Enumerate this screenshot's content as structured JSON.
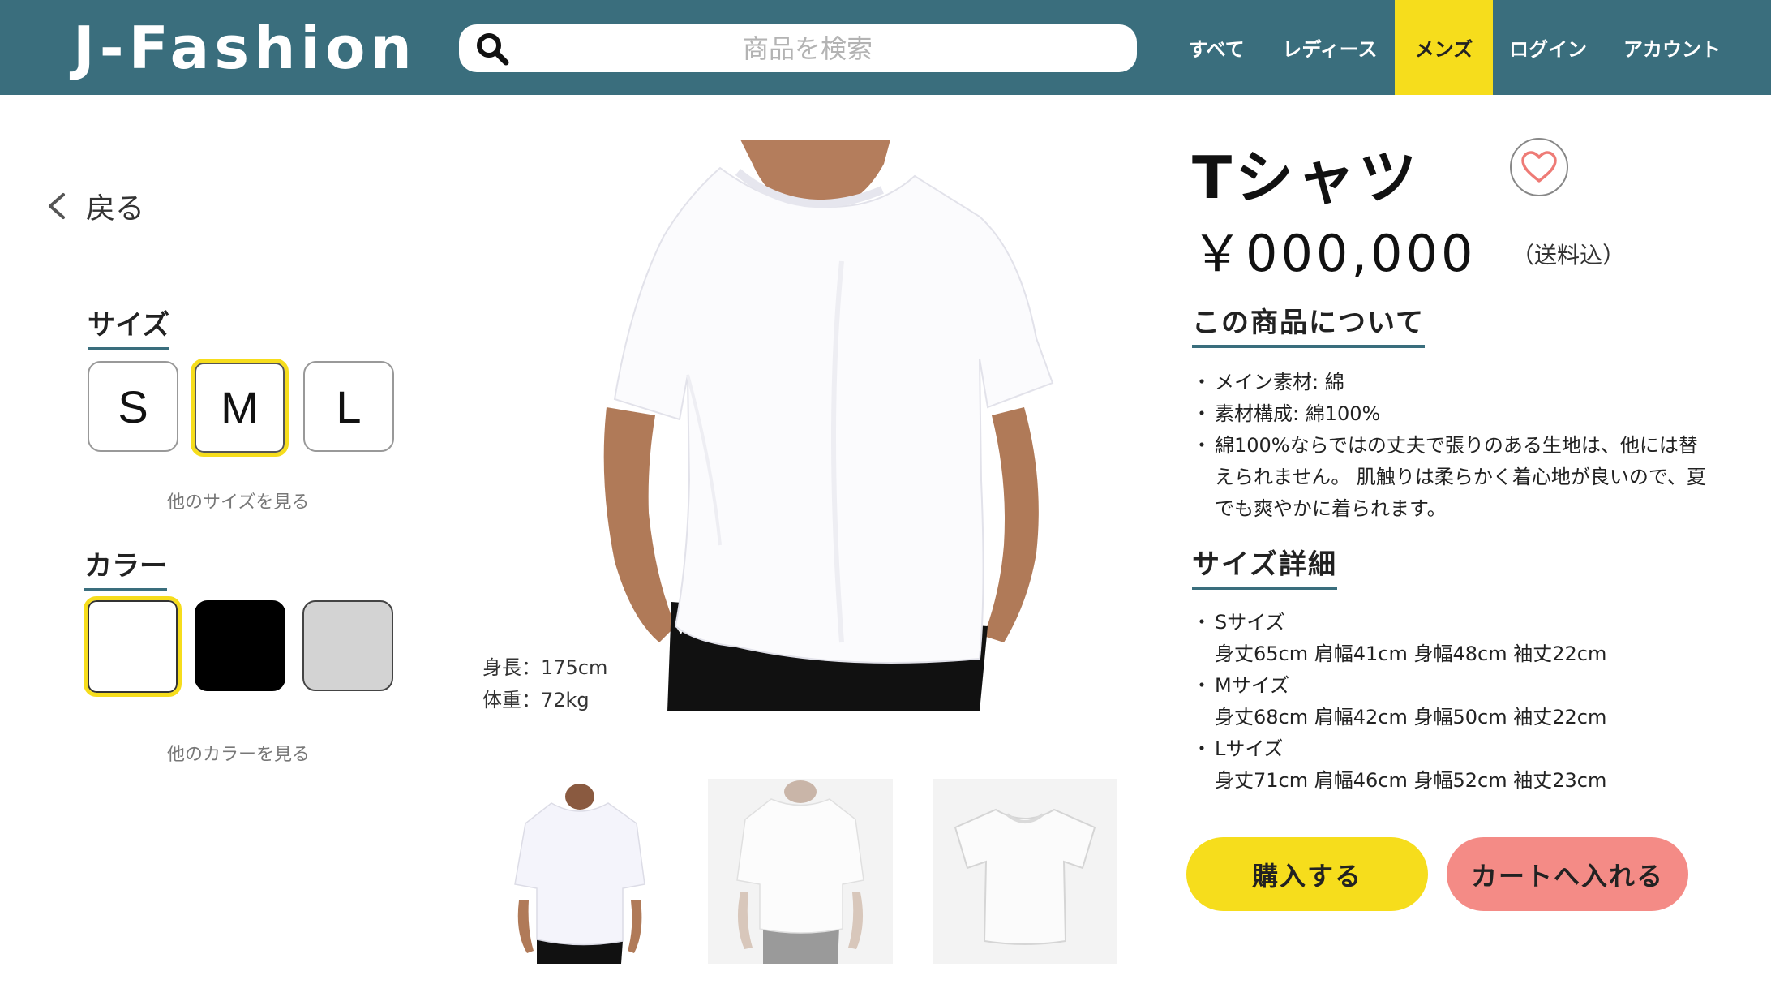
{
  "header": {
    "logo": "J-Fashion",
    "search_placeholder": "商品を検索",
    "nav": [
      {
        "label": "すべて",
        "active": false
      },
      {
        "label": "レディース",
        "active": false
      },
      {
        "label": "メンズ",
        "active": true
      },
      {
        "label": "ログイン",
        "active": false
      },
      {
        "label": "アカウント",
        "active": false
      }
    ]
  },
  "sidebar": {
    "back_label": "戻る",
    "size_title": "サイズ",
    "sizes": [
      {
        "label": "S",
        "selected": false
      },
      {
        "label": "M",
        "selected": true
      },
      {
        "label": "L",
        "selected": false
      }
    ],
    "more_sizes": "他のサイズを見る",
    "color_title": "カラー",
    "colors": [
      {
        "name": "white",
        "hex": "#ffffff",
        "selected": true
      },
      {
        "name": "black",
        "hex": "#000000",
        "selected": false
      },
      {
        "name": "gray",
        "hex": "#d3d3d3",
        "selected": false
      }
    ],
    "more_colors": "他のカラーを見る"
  },
  "gallery": {
    "model_height": "身長：175cm",
    "model_weight": "体重：72kg"
  },
  "product": {
    "title": "Tシャツ",
    "price": "￥000,000",
    "tax_note": "（送料込）",
    "about_title": "この商品について",
    "about_items": [
      "メイン素材: 綿",
      "素材構成: 綿100%",
      "綿100%ならではの丈夫で張りのある生地は、他には替えられません。 肌触りは柔らかく着心地が良いので、夏でも爽やかに着られます。"
    ],
    "size_detail_title": "サイズ詳細",
    "size_details": [
      {
        "name": "Sサイズ",
        "spec": "身丈65cm 肩幅41cm 身幅48cm 袖丈22cm"
      },
      {
        "name": "Mサイズ",
        "spec": "身丈68cm 肩幅42cm 身幅50cm 袖丈22cm"
      },
      {
        "name": "Lサイズ",
        "spec": "身丈71cm 肩幅46cm 身幅52cm 袖丈23cm"
      }
    ],
    "buy_label": "購入する",
    "cart_label": "カートへ入れる"
  },
  "colors": {
    "header_bg": "#3a6e7d",
    "accent_yellow": "#f6dd1c",
    "cart_pink": "#f48b86"
  }
}
